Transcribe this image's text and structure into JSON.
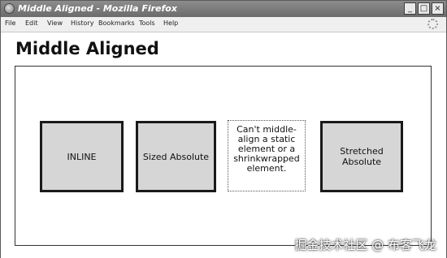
{
  "window": {
    "title": "Middle Aligned - Mozilla Firefox",
    "minimize_glyph": "_",
    "maximize_glyph": "□",
    "close_glyph": "×"
  },
  "menu": {
    "items": [
      {
        "label": "File"
      },
      {
        "label": "Edit"
      },
      {
        "label": "View"
      },
      {
        "label": "History"
      },
      {
        "label": "Bookmarks"
      },
      {
        "label": "Tools"
      },
      {
        "label": "Help"
      }
    ]
  },
  "page": {
    "heading": "Middle Aligned",
    "boxes": {
      "inline": "INLINE",
      "sized_absolute": "Sized Absolute",
      "static_note": "Can't middle-align a static element or a shrinkwrapped element.",
      "stretched_absolute": "Stretched Absolute"
    }
  },
  "watermark": "掘金技术社区 @ 布客飞龙"
}
